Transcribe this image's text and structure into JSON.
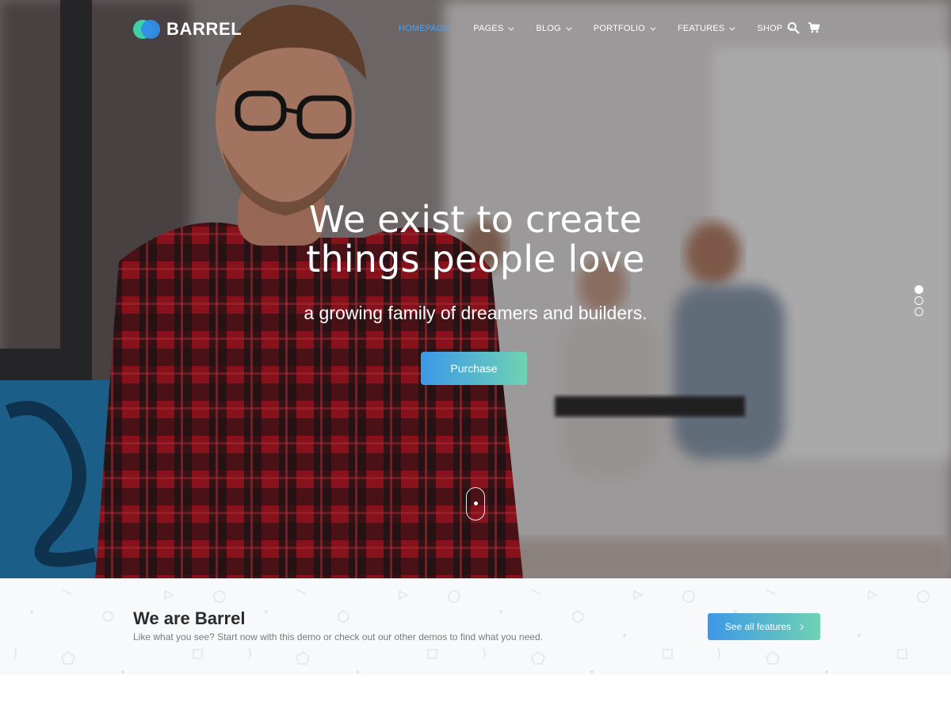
{
  "brand": {
    "name": "BARREL"
  },
  "nav": {
    "items": [
      {
        "label": "HOMEPAGE",
        "active": true,
        "dropdown": false
      },
      {
        "label": "PAGES",
        "active": false,
        "dropdown": true
      },
      {
        "label": "BLOG",
        "active": false,
        "dropdown": true
      },
      {
        "label": "PORTFOLIO",
        "active": false,
        "dropdown": true
      },
      {
        "label": "FEATURES",
        "active": false,
        "dropdown": true
      },
      {
        "label": "SHOP",
        "active": false,
        "dropdown": true
      }
    ],
    "icons": [
      "search-icon",
      "cart-icon"
    ]
  },
  "hero": {
    "headline_line1": "We exist to create",
    "headline_line2": "things people love",
    "subline": "a growing family of dreamers and builders.",
    "cta_label": "Purchase",
    "slides_total": 3,
    "active_slide": 1
  },
  "info": {
    "title": "We are Barrel",
    "description": "Like what you see? Start now with this demo or check out our other demos to find what you need.",
    "cta_label": "See all features"
  },
  "colors": {
    "accent_blue": "#3d98e8",
    "accent_green": "#6fd3b2",
    "active_nav": "#4fa3ef",
    "info_bg": "#f8f9fb"
  }
}
